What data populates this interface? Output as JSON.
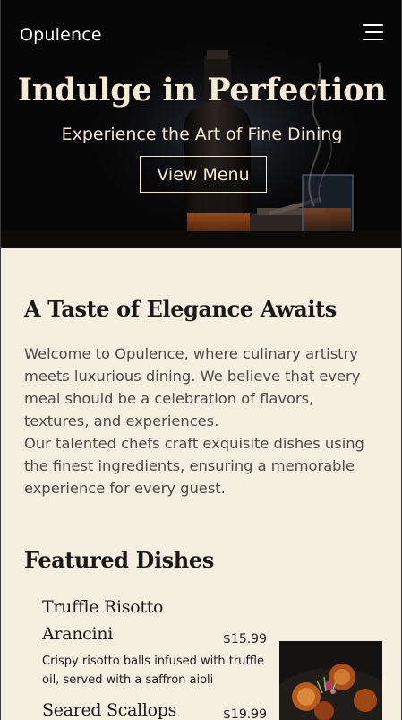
{
  "brand": {
    "name": "Opulence"
  },
  "hero": {
    "title": "Indulge in Perfection",
    "subtitle": "Experience the Art of Fine Dining",
    "cta_label": "View Menu"
  },
  "about": {
    "title": "A Taste of Elegance Awaits",
    "paragraphs": [
      "Welcome to Opulence, where culinary artistry meets luxurious dining. We believe that every meal should be a celebration of flavors, textures, and experiences.",
      "Our talented chefs craft exquisite dishes using the finest ingredients, ensuring a memorable experience for every guest."
    ]
  },
  "featured": {
    "title": "Featured Dishes",
    "dishes": [
      {
        "name_line1": "Truffle Risotto",
        "name_line2": "Arancini",
        "price": "$15.99",
        "description": "Crispy risotto balls infused with truffle oil, served with a saffron aioli"
      },
      {
        "name_line1": "Seared Scallops",
        "price": "$19.99"
      }
    ]
  },
  "colors": {
    "page_background": "#f5efe2",
    "hero_text": "#f4ead6",
    "heading_text": "#1c1a17",
    "body_text": "#4c4843"
  }
}
